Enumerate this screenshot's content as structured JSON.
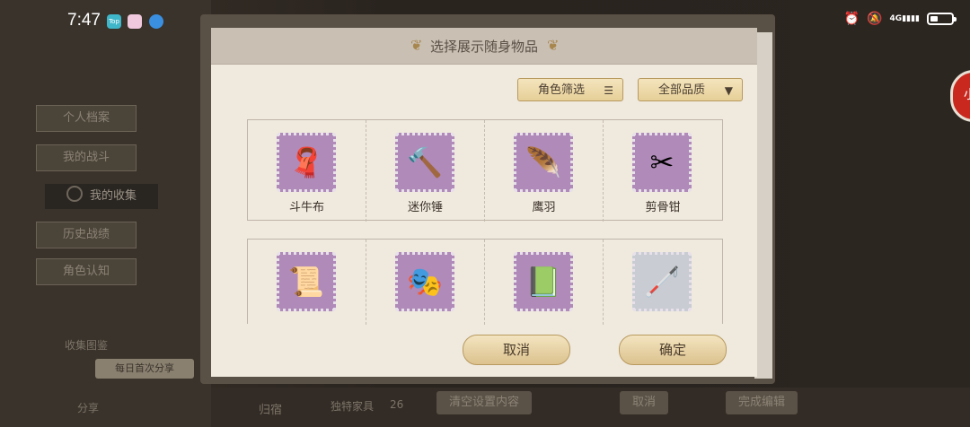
{
  "status_bar": {
    "time": "7:47",
    "apps": [
      {
        "icon": "top-app-icon",
        "color": "#3fb6c9",
        "label": "Top"
      },
      {
        "icon": "flower-app-icon",
        "color": "#e9a3c9"
      },
      {
        "icon": "browser-app-icon",
        "color": "#3a8fe0"
      }
    ],
    "right_icons": [
      "alarm-icon",
      "mute-icon",
      "signal-4g-icon",
      "battery-icon"
    ],
    "network": "4G"
  },
  "background": {
    "left_menu": [
      "个人档案",
      "我的战斗",
      "我的收集",
      "历史战绩",
      "角色认知"
    ],
    "active_menu_index": 2,
    "collection_label": "收集图鉴",
    "share_label": "分享",
    "daily_share_tag": "每日首次分享",
    "bottom_bar": {
      "dorm": "归宿",
      "unique_furniture": "独特家具",
      "furniture_count": "26",
      "clear_settings": "清空设置内容",
      "cancel": "取消",
      "finish_edit": "完成编辑"
    },
    "side_button_label": "小"
  },
  "modal": {
    "title": "选择展示随身物品",
    "filter_role": "角色筛选",
    "filter_quality": "全部品质",
    "items": [
      {
        "label": "斗牛布",
        "icon": "red-cape-icon",
        "glyph": "🧣",
        "frame": "purple"
      },
      {
        "label": "迷你锤",
        "icon": "mini-hammer-icon",
        "glyph": "🔨",
        "frame": "purple"
      },
      {
        "label": "鹰羽",
        "icon": "eagle-feather-icon",
        "glyph": "🪶",
        "frame": "purple"
      },
      {
        "label": "剪骨钳",
        "icon": "bone-pliers-icon",
        "glyph": "✂",
        "frame": "purple"
      },
      {
        "label": "",
        "icon": "scroll-icon",
        "glyph": "📜",
        "frame": "purple"
      },
      {
        "label": "",
        "icon": "mask-icon",
        "glyph": "🎭",
        "frame": "purple"
      },
      {
        "label": "",
        "icon": "green-book-icon",
        "glyph": "📗",
        "frame": "purple"
      },
      {
        "label": "",
        "icon": "cane-icon",
        "glyph": "🦯",
        "frame": "silver"
      }
    ],
    "cancel_label": "取消",
    "confirm_label": "确定"
  }
}
